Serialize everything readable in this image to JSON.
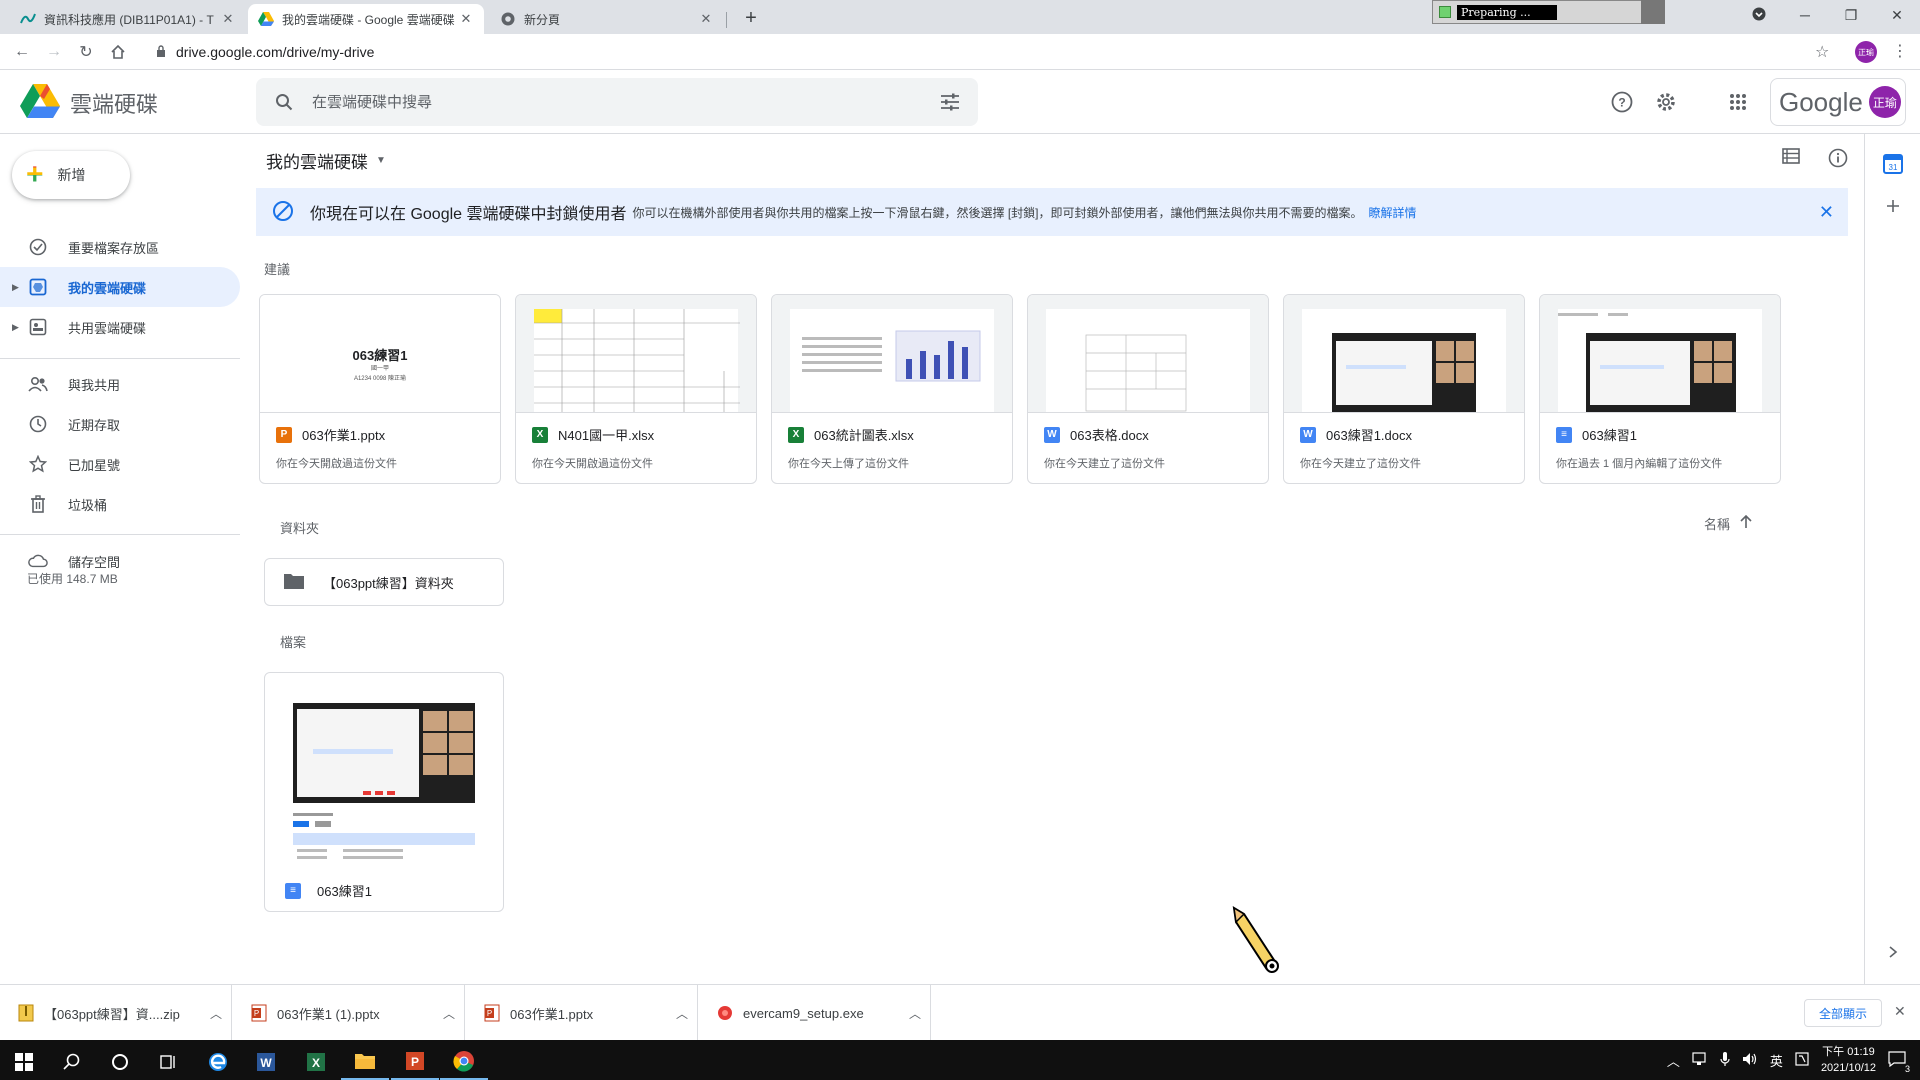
{
  "browser": {
    "tabs": [
      {
        "title": "資訊科技應用 (DIB11P01A1) - T",
        "icon": "wave-icon"
      },
      {
        "title": "我的雲端硬碟 - Google 雲端硬碟",
        "icon": "drive-icon"
      },
      {
        "title": "新分頁",
        "icon": "chrome-icon"
      }
    ],
    "url": "drive.google.com/drive/my-drive",
    "preparing_text": "Preparing ...",
    "profile_initials": "正瑜"
  },
  "header": {
    "app_name": "雲端硬碟",
    "search_placeholder": "在雲端硬碟中搜尋",
    "google_word": "Google",
    "avatar_initials": "正瑜"
  },
  "sidebar": {
    "new_label": "新增",
    "items": [
      {
        "label": "重要檔案存放區",
        "icon": "check-circle-icon"
      },
      {
        "label": "我的雲端硬碟",
        "icon": "drive-folder-icon"
      },
      {
        "label": "共用雲端硬碟",
        "icon": "shared-drive-icon"
      },
      {
        "label": "與我共用",
        "icon": "people-icon"
      },
      {
        "label": "近期存取",
        "icon": "clock-icon"
      },
      {
        "label": "已加星號",
        "icon": "star-icon"
      },
      {
        "label": "垃圾桶",
        "icon": "trash-icon"
      },
      {
        "label": "儲存空間",
        "icon": "cloud-icon"
      }
    ],
    "storage_used": "已使用 148.7 MB"
  },
  "main": {
    "breadcrumb": "我的雲端硬碟",
    "banner": {
      "title": "你現在可以在 Google 雲端硬碟中封鎖使用者",
      "body": "你可以在機構外部使用者與你共用的檔案上按一下滑鼠右鍵，然後選擇 [封鎖]，即可封鎖外部使用者，讓他們無法與你共用不需要的檔案。",
      "link": "瞭解詳情"
    },
    "suggested_label": "建議",
    "suggested": [
      {
        "name": "063作業1.pptx",
        "sub": "你在今天開啟過這份文件",
        "type": "P",
        "color": "#e8710a"
      },
      {
        "name": "N401國一甲.xlsx",
        "sub": "你在今天開啟過這份文件",
        "type": "X",
        "color": "#188038"
      },
      {
        "name": "063統計圖表.xlsx",
        "sub": "你在今天上傳了這份文件",
        "type": "X",
        "color": "#188038"
      },
      {
        "name": "063表格.docx",
        "sub": "你在今天建立了這份文件",
        "type": "W",
        "color": "#4285f4"
      },
      {
        "name": "063練習1.docx",
        "sub": "你在今天建立了這份文件",
        "type": "W",
        "color": "#4285f4"
      },
      {
        "name": "063練習1",
        "sub": "你在過去 1 個月內編輯了這份文件",
        "type": "≡",
        "color": "#4285f4"
      }
    ],
    "thumb_text": {
      "title": "063練習1",
      "line1": "國一甲",
      "line2": "A1234 0098 陳正瑜"
    },
    "folders_label": "資料夾",
    "sort_label": "名稱",
    "folder_name": "【063ppt練習】資料夾",
    "files_label": "檔案",
    "file_name": "063練習1"
  },
  "downloads": {
    "items": [
      {
        "name": "【063ppt練習】資....zip",
        "icon": "zip-icon"
      },
      {
        "name": "063作業1 (1).pptx",
        "icon": "pptx-icon"
      },
      {
        "name": "063作業1.pptx",
        "icon": "pptx-icon"
      },
      {
        "name": "evercam9_setup.exe",
        "icon": "exe-icon"
      }
    ],
    "show_all": "全部顯示"
  },
  "taskbar": {
    "ime": "英",
    "time": "下午 01:19",
    "date": "2021/10/12",
    "notification_count": "3"
  },
  "colors": {
    "accent": "#1a73e8",
    "active_nav_bg": "#e8f0fe",
    "avatar": "#8e24aa"
  }
}
